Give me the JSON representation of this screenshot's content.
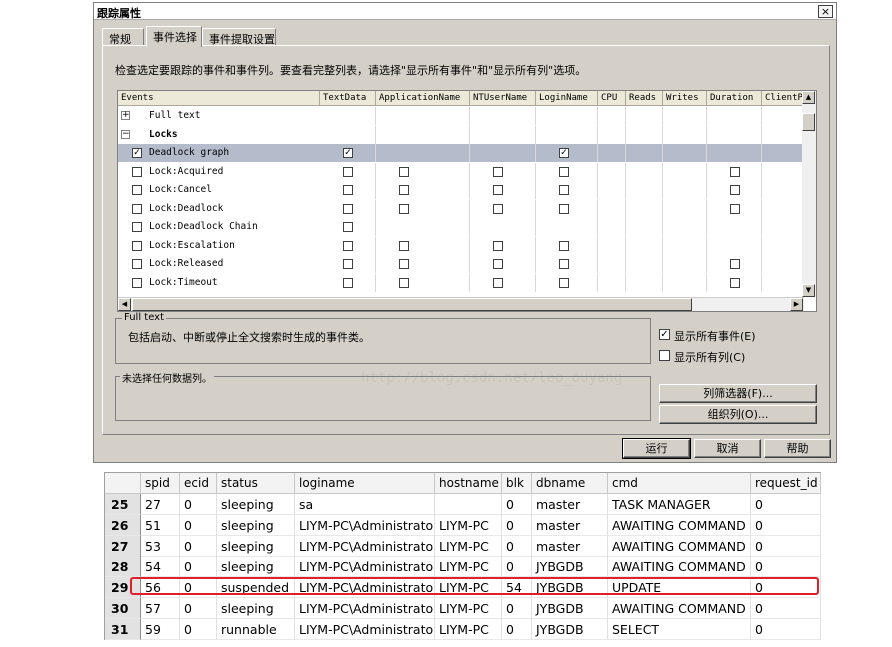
{
  "window": {
    "title": "跟踪属性",
    "close_glyph": "×"
  },
  "tabs": [
    "常规",
    "事件选择",
    "事件提取设置"
  ],
  "instruction": "检查选定要跟踪的事件和事件列。要查看完整列表，请选择\"显示所有事件\"和\"显示所有列\"选项。",
  "grid": {
    "columns": [
      "Events",
      "TextData",
      "ApplicationName",
      "NTUserName",
      "LoginName",
      "CPU",
      "Reads",
      "Writes",
      "Duration",
      "ClientP"
    ],
    "rows": [
      {
        "name": "Full text",
        "type": "category",
        "expander": "+",
        "checked": false,
        "cols": [
          false,
          false,
          false,
          false,
          false,
          false,
          false,
          false,
          false
        ],
        "bold": false
      },
      {
        "name": "Locks",
        "type": "category",
        "expander": "−",
        "checked": false,
        "cols": [
          false,
          false,
          false,
          false,
          false,
          false,
          false,
          false,
          false
        ],
        "bold": true
      },
      {
        "name": "Deadlock graph",
        "type": "event",
        "checked": true,
        "selected": true,
        "cols": [
          "on",
          "",
          "",
          "on",
          "",
          "",
          "",
          "",
          ""
        ]
      },
      {
        "name": "Lock:Acquired",
        "type": "event",
        "checked": false,
        "cols": [
          "off",
          "off",
          "off",
          "off",
          "",
          "",
          "",
          "off",
          ""
        ]
      },
      {
        "name": "Lock:Cancel",
        "type": "event",
        "checked": false,
        "cols": [
          "off",
          "off",
          "off",
          "off",
          "",
          "",
          "",
          "off",
          ""
        ]
      },
      {
        "name": "Lock:Deadlock",
        "type": "event",
        "checked": false,
        "cols": [
          "off",
          "off",
          "off",
          "off",
          "",
          "",
          "",
          "off",
          ""
        ]
      },
      {
        "name": "Lock:Deadlock Chain",
        "type": "event",
        "checked": false,
        "cols": [
          "off",
          "",
          "",
          "",
          "",
          "",
          "",
          "",
          ""
        ]
      },
      {
        "name": "Lock:Escalation",
        "type": "event",
        "checked": false,
        "cols": [
          "off",
          "off",
          "off",
          "off",
          "",
          "",
          "",
          "",
          ""
        ]
      },
      {
        "name": "Lock:Released",
        "type": "event",
        "checked": false,
        "cols": [
          "off",
          "off",
          "off",
          "off",
          "",
          "",
          "",
          "off",
          ""
        ]
      },
      {
        "name": "Lock:Timeout",
        "type": "event",
        "checked": false,
        "cols": [
          "off",
          "off",
          "off",
          "off",
          "",
          "",
          "",
          "off",
          ""
        ]
      }
    ]
  },
  "description": {
    "title": "Full text",
    "text": "包括启动、中断或停止全文搜索时生成的事件类。"
  },
  "watermark": "http://blog.csdn.net/leo_ouyang",
  "options": {
    "show_all_events": {
      "label": "显示所有事件(E)",
      "checked": true
    },
    "show_all_columns": {
      "label": "显示所有列(C)",
      "checked": false
    }
  },
  "column_group": {
    "label": "未选择任何数据列。"
  },
  "buttons": {
    "column_filters": "列筛选器(F)...",
    "organize_columns": "组织列(O)...",
    "run": "运行",
    "cancel": "取消",
    "help": "帮助"
  },
  "results": {
    "columns": [
      "spid",
      "ecid",
      "status",
      "loginame",
      "hostname",
      "blk",
      "dbname",
      "cmd",
      "request_id"
    ],
    "rows": [
      {
        "num": "25",
        "cells": [
          "27",
          "0",
          "sleeping",
          "sa",
          "",
          "0",
          "master",
          "TASK MANAGER",
          "0"
        ]
      },
      {
        "num": "26",
        "cells": [
          "51",
          "0",
          "sleeping",
          "LIYM-PC\\Administrator",
          "LIYM-PC",
          "0",
          "master",
          "AWAITING COMMAND",
          "0"
        ]
      },
      {
        "num": "27",
        "cells": [
          "53",
          "0",
          "sleeping",
          "LIYM-PC\\Administrator",
          "LIYM-PC",
          "0",
          "master",
          "AWAITING COMMAND",
          "0"
        ]
      },
      {
        "num": "28",
        "cells": [
          "54",
          "0",
          "sleeping",
          "LIYM-PC\\Administrator",
          "LIYM-PC",
          "0",
          "JYBGDB",
          "AWAITING COMMAND",
          "0"
        ]
      },
      {
        "num": "29",
        "cells": [
          "56",
          "0",
          "suspended",
          "LIYM-PC\\Administrator",
          "LIYM-PC",
          "54",
          "JYBGDB",
          "UPDATE",
          "0"
        ],
        "highlighted": true
      },
      {
        "num": "30",
        "cells": [
          "57",
          "0",
          "sleeping",
          "LIYM-PC\\Administrator",
          "LIYM-PC",
          "0",
          "JYBGDB",
          "AWAITING COMMAND",
          "0"
        ]
      },
      {
        "num": "31",
        "cells": [
          "59",
          "0",
          "runnable",
          "LIYM-PC\\Administrator",
          "LIYM-PC",
          "0",
          "JYBGDB",
          "SELECT",
          "0"
        ]
      }
    ],
    "highlight_color": "#e0202a"
  }
}
